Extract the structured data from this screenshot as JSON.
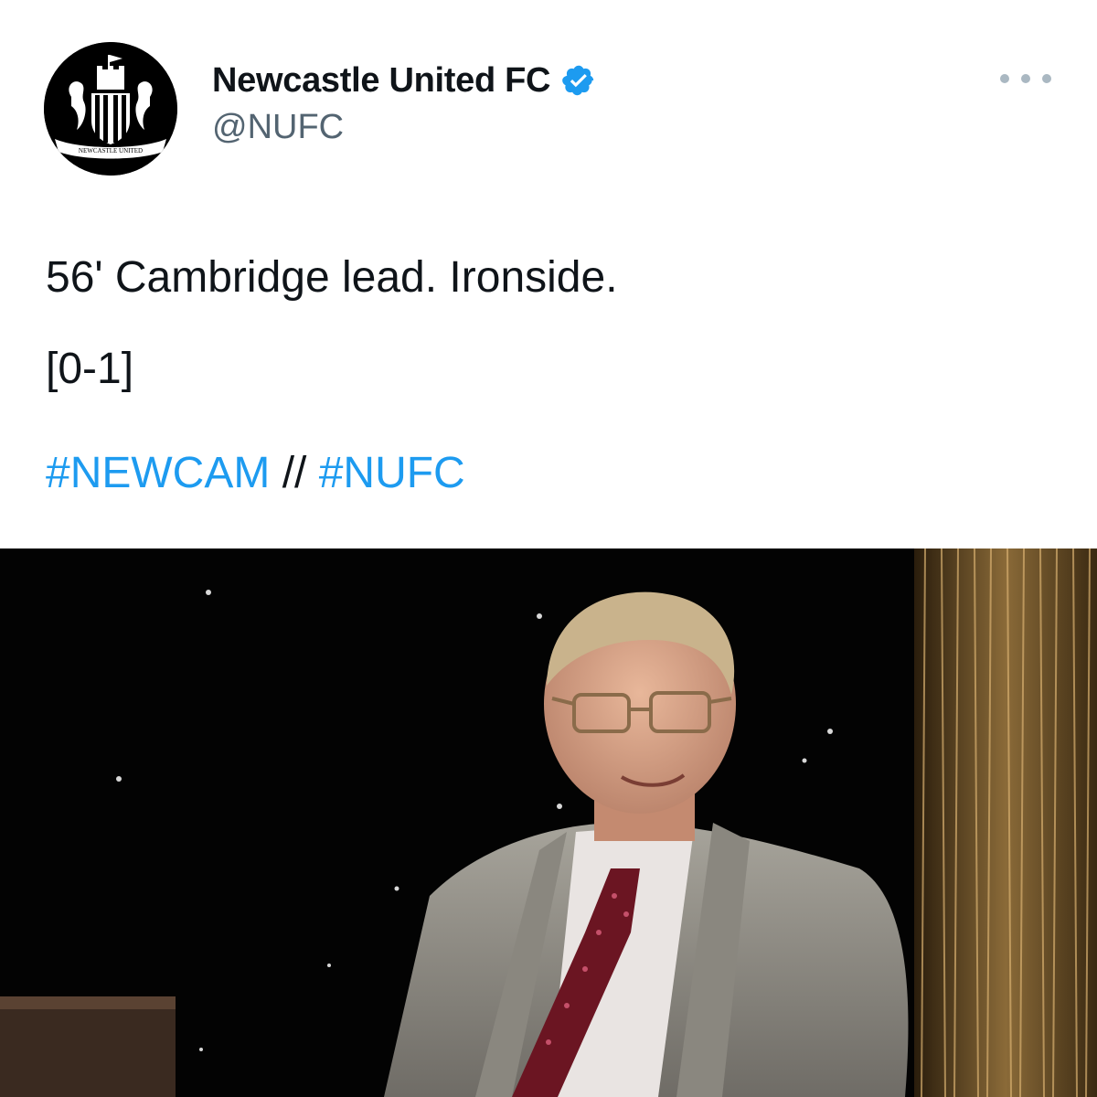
{
  "tweet": {
    "author": {
      "display_name": "Newcastle United FC",
      "handle": "@NUFC",
      "verified": true,
      "avatar_icon": "newcastle-united-crest-icon",
      "avatar_crest_text": "NEWCASTLE UNITED"
    },
    "more_icon": "more-horizontal-icon",
    "text": {
      "line1": "56' Cambridge lead. Ironside.",
      "line2": "[0-1]",
      "hashtag1": "#NEWCAM",
      "separator": "//",
      "hashtag2": "#NUFC"
    },
    "media": {
      "kind": "photo",
      "subject": "man-in-grey-suit-and-red-tie-photo"
    }
  },
  "colors": {
    "text_primary": "#0f1419",
    "text_secondary": "#536471",
    "link": "#1d9bf0",
    "verified": "#1d9bf0",
    "media_background": "#030303"
  }
}
